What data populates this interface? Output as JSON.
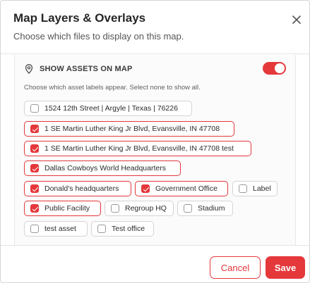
{
  "dialog": {
    "title": "Map Layers & Overlays",
    "subtitle": "Choose which files to display on this map."
  },
  "assets_section": {
    "title": "SHOW ASSETS ON MAP",
    "toggle_on": true,
    "hint": "Choose which asset labels appear. Select none to show all.",
    "labels": [
      {
        "label": "1524 12th Street | Argyle | Texas | 76226",
        "checked": false
      },
      {
        "label": "1 SE Martin Luther King Jr Blvd, Evansville, IN 47708",
        "checked": true
      },
      {
        "label": "1 SE Martin Luther King Jr Blvd, Evansville, IN 47708 test",
        "checked": true
      },
      {
        "label": "Dallas Cowboys World Headquarters",
        "checked": true
      },
      {
        "label": "Donald's headquarters",
        "checked": true
      },
      {
        "label": "Government Office",
        "checked": true
      },
      {
        "label": "Label",
        "checked": false
      },
      {
        "label": "Public Facility",
        "checked": true
      },
      {
        "label": "Regroup HQ",
        "checked": false
      },
      {
        "label": "Stadium",
        "checked": false
      },
      {
        "label": "test asset",
        "checked": false
      },
      {
        "label": "Test office",
        "checked": false
      }
    ]
  },
  "footer": {
    "cancel_label": "Cancel",
    "save_label": "Save"
  },
  "colors": {
    "accent": "#e5383b",
    "border": "#d4d4d4",
    "text": "#2b2b2b"
  },
  "icons": {
    "close": "close-icon",
    "location": "location-pin-icon",
    "checkbox": "checkmark-icon"
  }
}
